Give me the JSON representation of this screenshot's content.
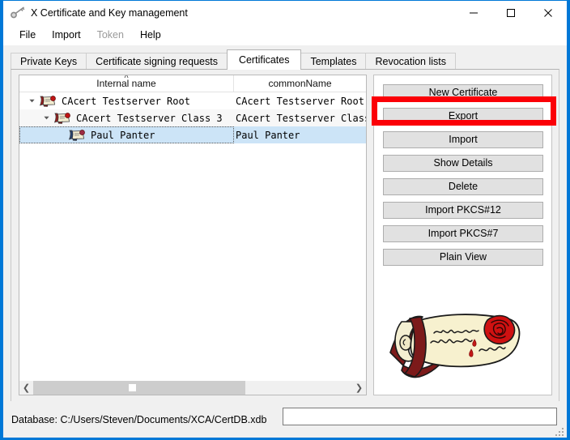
{
  "window": {
    "title": "X Certificate and Key management",
    "icon": "key-icon",
    "controls": {
      "minimize": "minimize-icon",
      "maximize": "maximize-icon",
      "close": "close-icon"
    }
  },
  "menu": {
    "items": [
      {
        "label": "File",
        "disabled": false
      },
      {
        "label": "Import",
        "disabled": false
      },
      {
        "label": "Token",
        "disabled": true
      },
      {
        "label": "Help",
        "disabled": false
      }
    ]
  },
  "tabs": [
    {
      "label": "Private Keys",
      "active": false
    },
    {
      "label": "Certificate signing requests",
      "active": false
    },
    {
      "label": "Certificates",
      "active": true
    },
    {
      "label": "Templates",
      "active": false
    },
    {
      "label": "Revocation lists",
      "active": false
    }
  ],
  "tree": {
    "columns": [
      {
        "label": "Internal name",
        "sorted": true,
        "sort_indicator": "˄"
      },
      {
        "label": "commonName",
        "sorted": false,
        "sort_indicator": ""
      }
    ],
    "rows": [
      {
        "internal_name": "CAcert Testserver Root",
        "common_name": "CAcert Testserver Root",
        "depth": 0,
        "expanded": true,
        "selected": false,
        "alt": false,
        "icon": "certificate-icon"
      },
      {
        "internal_name": "CAcert Testserver Class 3",
        "common_name": "CAcert Testserver Class",
        "depth": 1,
        "expanded": true,
        "selected": false,
        "alt": true,
        "icon": "certificate-icon"
      },
      {
        "internal_name": "Paul Panter",
        "common_name": "Paul Panter",
        "depth": 2,
        "expanded": null,
        "selected": true,
        "alt": false,
        "icon": "certificate-icon"
      }
    ],
    "scrollbar": {
      "left_arrow": "chevron-left-icon",
      "right_arrow": "chevron-right-icon"
    }
  },
  "side_buttons": [
    {
      "label": "New Certificate",
      "highlighted": false
    },
    {
      "label": "Export",
      "highlighted": true
    },
    {
      "label": "Import",
      "highlighted": false
    },
    {
      "label": "Show Details",
      "highlighted": false
    },
    {
      "label": "Delete",
      "highlighted": false
    },
    {
      "label": "Import PKCS#12",
      "highlighted": false
    },
    {
      "label": "Import PKCS#7",
      "highlighted": false
    },
    {
      "label": "Plain View",
      "highlighted": false
    }
  ],
  "logo": {
    "name": "xca-scroll-logo",
    "script_line1": "Jasminecta",
    "script_line2": "Wiednovob",
    "script_line3": "Zina"
  },
  "status_bar": {
    "database_label": "Database: C:/Users/Steven/Documents/XCA/CertDB.xdb",
    "input_value": "",
    "input_placeholder": ""
  },
  "colors": {
    "accent_border": "#0078d7",
    "highlight_red": "#fb0007",
    "selection_blue": "#cce4f7",
    "button_face": "#e1e1e1",
    "window_bg": "#f0f0f0"
  }
}
